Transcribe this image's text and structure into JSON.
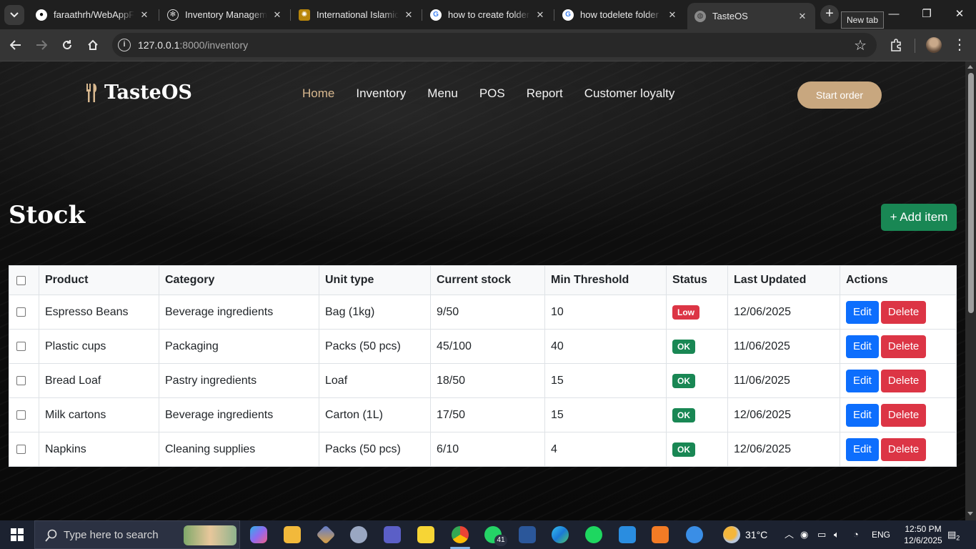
{
  "browser": {
    "tabs": [
      {
        "title": "faraathrh/WebAppFin",
        "icon": "github-icon"
      },
      {
        "title": "Inventory Manageme",
        "icon": "openai-icon"
      },
      {
        "title": "International Islamic U",
        "icon": "university-icon"
      },
      {
        "title": "how to create folder i",
        "icon": "google-icon"
      },
      {
        "title": "how todelete folder a",
        "icon": "google-icon"
      },
      {
        "title": "TasteOS",
        "icon": "globe-icon"
      }
    ],
    "new_tab_tooltip": "New tab",
    "url_host": "127.0.0.1",
    "url_rest": ":8000/inventory"
  },
  "site": {
    "brand": "TasteOS",
    "nav": [
      "Home",
      "Inventory",
      "Menu",
      "POS",
      "Report",
      "Customer loyalty"
    ],
    "active_nav": "Home",
    "cta": "Start order",
    "accent_color": "#c8a77f"
  },
  "stock": {
    "title": "Stock",
    "add_button": "+ Add item",
    "columns": [
      "Product",
      "Category",
      "Unit type",
      "Current stock",
      "Min Threshold",
      "Status",
      "Last Updated",
      "Actions"
    ],
    "rows": [
      {
        "product": "Espresso Beans",
        "category": "Beverage ingredients",
        "unit": "Bag (1kg)",
        "current": "9/50",
        "min": "10",
        "status": "Low",
        "updated": "12/06/2025"
      },
      {
        "product": "Plastic cups",
        "category": "Packaging",
        "unit": "Packs (50 pcs)",
        "current": "45/100",
        "min": "40",
        "status": "OK",
        "updated": "11/06/2025"
      },
      {
        "product": "Bread Loaf",
        "category": "Pastry ingredients",
        "unit": "Loaf",
        "current": "18/50",
        "min": "15",
        "status": "OK",
        "updated": "11/06/2025"
      },
      {
        "product": "Milk cartons",
        "category": "Beverage ingredients",
        "unit": "Carton (1L)",
        "current": "17/50",
        "min": "15",
        "status": "OK",
        "updated": "12/06/2025"
      },
      {
        "product": "Napkins",
        "category": "Cleaning supplies",
        "unit": "Packs (50 pcs)",
        "current": "6/10",
        "min": "4",
        "status": "OK",
        "updated": "12/06/2025"
      }
    ],
    "edit_label": "Edit",
    "delete_label": "Delete"
  },
  "taskbar": {
    "search_placeholder": "Type here to search",
    "whatsapp_badge": "41",
    "temperature": "31°C",
    "language": "ENG",
    "time": "12:50 PM",
    "date": "12/6/2025",
    "notifications": "2"
  }
}
